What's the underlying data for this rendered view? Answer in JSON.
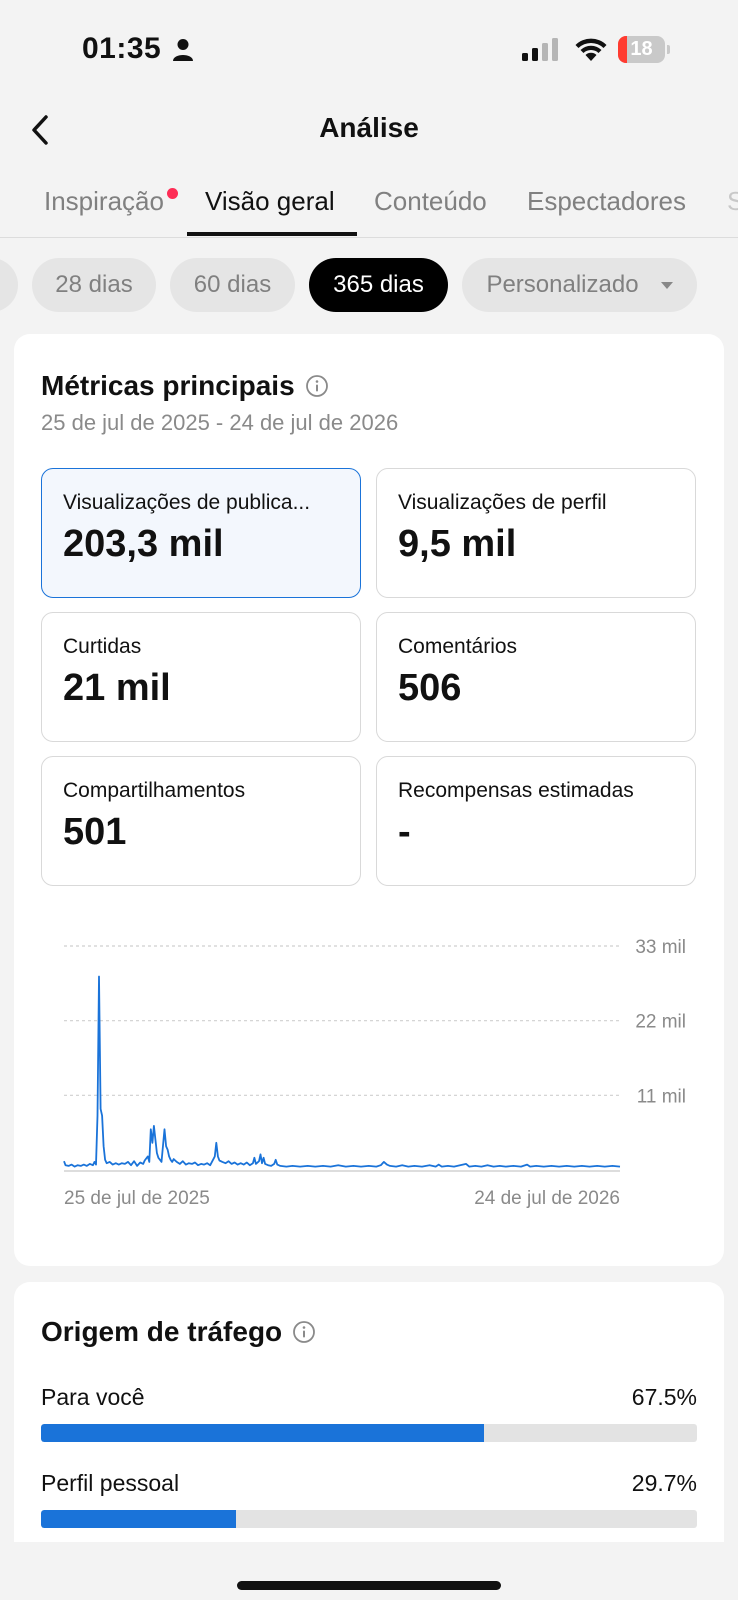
{
  "status_bar": {
    "time": "01:35",
    "battery": "18"
  },
  "header": {
    "title": "Análise"
  },
  "tabs": [
    {
      "label": "Inspiração",
      "has_dot": true
    },
    {
      "label": "Visão geral",
      "active": true
    },
    {
      "label": "Conteúdo"
    },
    {
      "label": "Espectadores"
    },
    {
      "label": "S"
    }
  ],
  "period_chips": [
    {
      "label": "28 dias"
    },
    {
      "label": "60 dias"
    },
    {
      "label": "365 dias",
      "active": true
    },
    {
      "label": "Personalizado",
      "dropdown": true
    }
  ],
  "key_metrics": {
    "title": "Métricas principais",
    "date_range": "25 de jul de 2025 - 24 de jul de 2026",
    "cards": [
      {
        "label": "Visualizações de publica...",
        "value": "203,3 mil",
        "selected": true
      },
      {
        "label": "Visualizações de perfil",
        "value": "9,5 mil"
      },
      {
        "label": "Curtidas",
        "value": "21 mil"
      },
      {
        "label": "Comentários",
        "value": "506"
      },
      {
        "label": "Compartilhamentos",
        "value": "501"
      },
      {
        "label": "Recompensas estimadas",
        "value": "-"
      }
    ]
  },
  "chart_data": {
    "type": "line",
    "title": "",
    "series_color": "#1a73d9",
    "x_start_label": "25 de jul de 2025",
    "x_end_label": "24 de jul de 2026",
    "y_tick_labels": [
      "33 mil",
      "22 mil",
      "11 mil"
    ],
    "y_ticks": [
      33000,
      22000,
      11000
    ],
    "ylim": [
      0,
      33000
    ],
    "grid": "dashed horizontal",
    "x_days": 365,
    "points": [
      [
        0,
        1300
      ],
      [
        1,
        700
      ],
      [
        3,
        600
      ],
      [
        5,
        800
      ],
      [
        7,
        500
      ],
      [
        9,
        700
      ],
      [
        11,
        600
      ],
      [
        13,
        800
      ],
      [
        15,
        600
      ],
      [
        17,
        900
      ],
      [
        19,
        700
      ],
      [
        20,
        1200
      ],
      [
        21,
        800
      ],
      [
        22,
        8000
      ],
      [
        23,
        28500
      ],
      [
        24,
        9000
      ],
      [
        25,
        8000
      ],
      [
        26,
        3500
      ],
      [
        27,
        1500
      ],
      [
        28,
        1000
      ],
      [
        30,
        1200
      ],
      [
        32,
        800
      ],
      [
        34,
        1000
      ],
      [
        36,
        800
      ],
      [
        38,
        1000
      ],
      [
        40,
        900
      ],
      [
        42,
        1200
      ],
      [
        44,
        700
      ],
      [
        46,
        1300
      ],
      [
        48,
        600
      ],
      [
        50,
        1100
      ],
      [
        52,
        900
      ],
      [
        53,
        1400
      ],
      [
        55,
        2000
      ],
      [
        56,
        1200
      ],
      [
        57,
        6000
      ],
      [
        58,
        4000
      ],
      [
        59,
        6500
      ],
      [
        60,
        4500
      ],
      [
        61,
        2500
      ],
      [
        62,
        1800
      ],
      [
        63,
        1500
      ],
      [
        64,
        1200
      ],
      [
        66,
        6000
      ],
      [
        67,
        3500
      ],
      [
        68,
        3000
      ],
      [
        69,
        2000
      ],
      [
        70,
        1500
      ],
      [
        71,
        1200
      ],
      [
        72,
        1600
      ],
      [
        74,
        1200
      ],
      [
        76,
        900
      ],
      [
        78,
        1300
      ],
      [
        80,
        800
      ],
      [
        82,
        1000
      ],
      [
        84,
        900
      ],
      [
        86,
        1100
      ],
      [
        88,
        700
      ],
      [
        90,
        900
      ],
      [
        92,
        800
      ],
      [
        94,
        1000
      ],
      [
        96,
        700
      ],
      [
        99,
        2000
      ],
      [
        100,
        4000
      ],
      [
        101,
        2000
      ],
      [
        102,
        1400
      ],
      [
        104,
        1200
      ],
      [
        106,
        1000
      ],
      [
        108,
        1300
      ],
      [
        110,
        900
      ],
      [
        112,
        1100
      ],
      [
        114,
        800
      ],
      [
        116,
        1000
      ],
      [
        118,
        800
      ],
      [
        120,
        1100
      ],
      [
        122,
        700
      ],
      [
        124,
        1000
      ],
      [
        125,
        1800
      ],
      [
        126,
        900
      ],
      [
        128,
        1300
      ],
      [
        129,
        2300
      ],
      [
        130,
        1000
      ],
      [
        131,
        1800
      ],
      [
        132,
        900
      ],
      [
        134,
        700
      ],
      [
        136,
        600
      ],
      [
        138,
        900
      ],
      [
        139,
        1500
      ],
      [
        140,
        800
      ],
      [
        142,
        600
      ],
      [
        146,
        500
      ],
      [
        150,
        600
      ],
      [
        155,
        500
      ],
      [
        160,
        600
      ],
      [
        165,
        500
      ],
      [
        170,
        600
      ],
      [
        175,
        500
      ],
      [
        180,
        700
      ],
      [
        185,
        500
      ],
      [
        190,
        600
      ],
      [
        195,
        500
      ],
      [
        200,
        600
      ],
      [
        205,
        500
      ],
      [
        208,
        700
      ],
      [
        210,
        1200
      ],
      [
        212,
        800
      ],
      [
        214,
        600
      ],
      [
        218,
        500
      ],
      [
        222,
        700
      ],
      [
        226,
        500
      ],
      [
        230,
        600
      ],
      [
        235,
        500
      ],
      [
        240,
        700
      ],
      [
        244,
        500
      ],
      [
        246,
        800
      ],
      [
        248,
        500
      ],
      [
        252,
        600
      ],
      [
        256,
        500
      ],
      [
        260,
        700
      ],
      [
        264,
        900
      ],
      [
        266,
        500
      ],
      [
        270,
        600
      ],
      [
        274,
        500
      ],
      [
        278,
        700
      ],
      [
        282,
        500
      ],
      [
        286,
        600
      ],
      [
        290,
        500
      ],
      [
        295,
        600
      ],
      [
        300,
        500
      ],
      [
        304,
        800
      ],
      [
        306,
        500
      ],
      [
        310,
        600
      ],
      [
        315,
        500
      ],
      [
        320,
        600
      ],
      [
        325,
        500
      ],
      [
        330,
        600
      ],
      [
        335,
        500
      ],
      [
        340,
        600
      ],
      [
        345,
        500
      ],
      [
        350,
        600
      ],
      [
        355,
        500
      ],
      [
        360,
        600
      ],
      [
        365,
        500
      ]
    ]
  },
  "traffic": {
    "title": "Origem de tráfego",
    "rows": [
      {
        "label": "Para você",
        "pct_label": "67.5%",
        "value": 67.5
      },
      {
        "label": "Perfil pessoal",
        "pct_label": "29.7%",
        "value": 29.7
      }
    ]
  },
  "colors": {
    "accent": "#1a73d9",
    "notification_dot": "#fe2c55",
    "battery_low": "#ff3b30"
  }
}
